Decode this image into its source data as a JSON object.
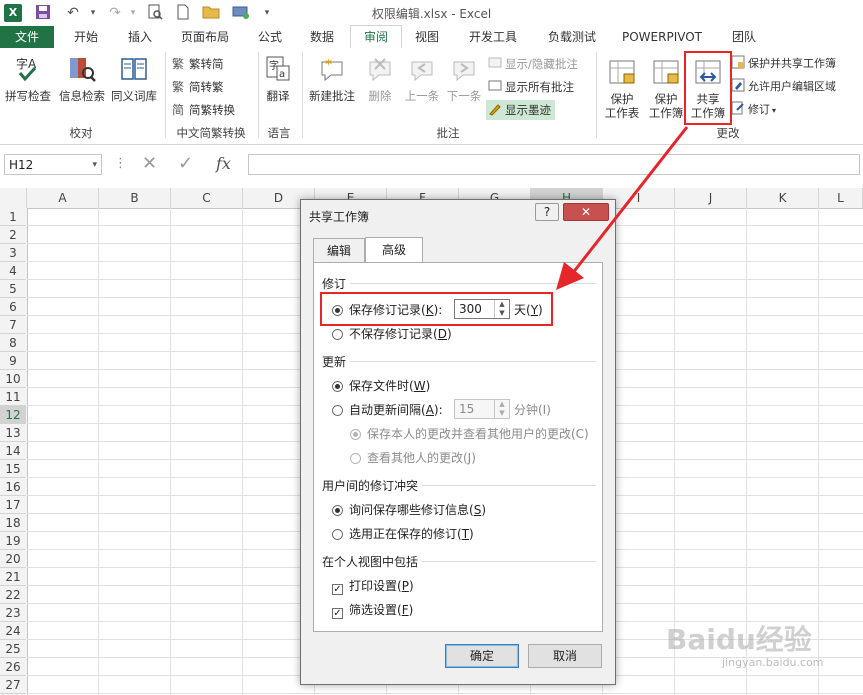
{
  "window": {
    "title": "权限编辑.xlsx - Excel"
  },
  "tabs": [
    "文件",
    "开始",
    "插入",
    "页面布局",
    "公式",
    "数据",
    "审阅",
    "视图",
    "开发工具",
    "负载测试",
    "POWERPIVOT",
    "团队"
  ],
  "ribbon": {
    "proofing": {
      "spell": "拼写检查",
      "research": "信息检索",
      "thesaurus": "同义词库",
      "label": "校对"
    },
    "chinese": {
      "t2s": "繁转简",
      "s2t": "简转繁",
      "convert": "简繁转换",
      "label": "中文简繁转换"
    },
    "language": {
      "translate": "翻译",
      "label": "语言"
    },
    "comments": {
      "new": "新建批注",
      "delete": "删除",
      "prev": "上一条",
      "next": "下一条",
      "showhide": "显示/隐藏批注",
      "showall": "显示所有批注",
      "ink": "显示墨迹",
      "label": "批注"
    },
    "changes": {
      "protect_sheet_1": "保护",
      "protect_sheet_2": "工作表",
      "protect_wb_1": "保护",
      "protect_wb_2": "工作簿",
      "share_1": "共享",
      "share_2": "工作簿",
      "protect_share": "保护并共享工作簿",
      "allow_edit": "允许用户编辑区域",
      "track": "修订",
      "label": "更改"
    }
  },
  "formula_bar": {
    "name_box": "H12",
    "fx": "fx",
    "value": ""
  },
  "columns": [
    "A",
    "B",
    "C",
    "D",
    "E",
    "F",
    "G",
    "H",
    "I",
    "J",
    "K",
    "L"
  ],
  "selected_column": "H",
  "rows": [
    "1",
    "2",
    "3",
    "4",
    "5",
    "6",
    "7",
    "8",
    "9",
    "10",
    "11",
    "12",
    "13",
    "14",
    "15",
    "16",
    "17",
    "18",
    "19",
    "20",
    "21",
    "22",
    "23",
    "24",
    "25",
    "26",
    "27"
  ],
  "selected_row": "12",
  "dialog": {
    "title": "共享工作簿",
    "help": "?",
    "tabs": {
      "edit": "编辑",
      "advanced": "高级"
    },
    "revisions": {
      "heading": "修订",
      "keep_prefix": "保存修订记录(",
      "keep_key": "K",
      "keep_suffix": "):",
      "days_value": "300",
      "days_prefix": "天(",
      "days_key": "Y",
      "days_suffix": ")",
      "no_keep_prefix": "不保存修订记录(",
      "no_keep_key": "D",
      "no_keep_suffix": ")"
    },
    "update": {
      "heading": "更新",
      "on_save_prefix": "保存文件时(",
      "on_save_key": "W",
      "on_save_suffix": ")",
      "auto_prefix": "自动更新间隔(",
      "auto_key": "A",
      "auto_suffix": "):",
      "interval_value": "15",
      "minutes_label": "分钟(I)",
      "save_mine": "保存本人的更改并查看其他用户的更改(C)",
      "see_others": "查看其他人的更改(J)"
    },
    "conflicts": {
      "heading": "用户间的修订冲突",
      "ask_prefix": "询问保存哪些修订信息(",
      "ask_key": "S",
      "ask_suffix": ")",
      "win_prefix": "选用正在保存的修订(",
      "win_key": "T",
      "win_suffix": ")"
    },
    "personal": {
      "heading": "在个人视图中包括",
      "print_prefix": "打印设置(",
      "print_key": "P",
      "print_suffix": ")",
      "filter_prefix": "筛选设置(",
      "filter_key": "F",
      "filter_suffix": ")"
    },
    "ok": "确定",
    "cancel": "取消"
  },
  "watermark": {
    "brand": "Baidu经验",
    "url": "jingyan.baidu.com"
  },
  "colors": {
    "excel_green": "#217346",
    "annotation_red": "#e5262a"
  }
}
